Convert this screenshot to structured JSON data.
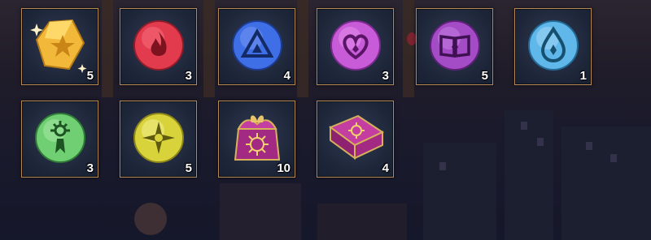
{
  "inventory": {
    "items": [
      {
        "icon": "gold-crystal-icon",
        "quantity": "5"
      },
      {
        "icon": "fire-orb-icon",
        "quantity": "3"
      },
      {
        "icon": "triangle-orb-icon",
        "quantity": "4"
      },
      {
        "icon": "heart-orb-icon",
        "quantity": "3"
      },
      {
        "icon": "book-orb-icon",
        "quantity": "5"
      },
      {
        "icon": "water-drop-orb-icon",
        "quantity": "1"
      },
      {
        "icon": "sun-figure-orb-icon",
        "quantity": "3"
      },
      {
        "icon": "compass-star-orb-icon",
        "quantity": "5"
      },
      {
        "icon": "gift-bag-icon",
        "quantity": "10"
      },
      {
        "icon": "gift-box-icon",
        "quantity": "4"
      }
    ]
  },
  "colors": {
    "slot_border": "#b58a55",
    "fire": "#e23b4e",
    "triangle": "#3f6fe6",
    "heart": "#c85bd8",
    "book": "#a44bc6",
    "water": "#5fb7ea",
    "sun_figure": "#6fcf72",
    "compass": "#d9d33b",
    "gift": "#a22a82",
    "gold": "#f2b83a"
  }
}
